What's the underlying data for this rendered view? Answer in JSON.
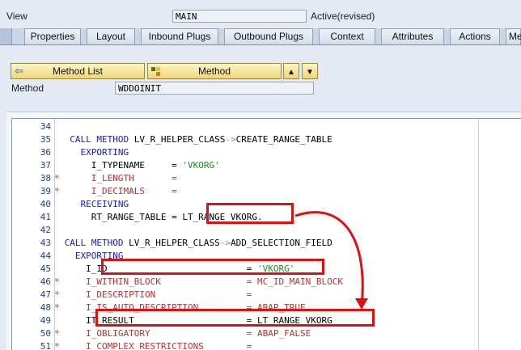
{
  "header": {
    "view_label": "View",
    "view_value": "MAIN",
    "status": "Active(revised)"
  },
  "tabs": [
    "Properties",
    "Layout",
    "Inbound Plugs",
    "Outbound Plugs",
    "Context",
    "Attributes",
    "Actions",
    "Me"
  ],
  "toolbar": {
    "method_list_label": "Method List",
    "method_label": "Method",
    "up_icon": "triangle-up-icon",
    "down_icon": "triangle-down-icon"
  },
  "method_field": {
    "label": "Method",
    "value": "WDDOINIT"
  },
  "code": {
    "lines": [
      {
        "num": "34",
        "marker": "",
        "text": ""
      },
      {
        "num": "35",
        "marker": "",
        "text": "  CALL METHOD LV_R_HELPER_CLASS->CREATE_RANGE_TABLE"
      },
      {
        "num": "36",
        "marker": "",
        "text": "    EXPORTING"
      },
      {
        "num": "37",
        "marker": "",
        "text": "      I_TYPENAME     = 'VKORG'"
      },
      {
        "num": "38",
        "marker": "*",
        "text": "      I_LENGTH       ="
      },
      {
        "num": "39",
        "marker": "*",
        "text": "      I_DECIMALS     ="
      },
      {
        "num": "40",
        "marker": "",
        "text": "    RECEIVING"
      },
      {
        "num": "41",
        "marker": "",
        "text": "      RT_RANGE_TABLE = LT_RANGE_VKORG."
      },
      {
        "num": "42",
        "marker": "",
        "text": ""
      },
      {
        "num": "43",
        "marker": "",
        "text": " CALL METHOD LV_R_HELPER_CLASS->ADD_SELECTION_FIELD"
      },
      {
        "num": "44",
        "marker": "",
        "text": "   EXPORTING"
      },
      {
        "num": "45",
        "marker": "",
        "text": "     I_ID                          = 'VKORG'"
      },
      {
        "num": "46",
        "marker": "*",
        "text": "     I_WITHIN_BLOCK                = MC_ID_MAIN_BLOCK"
      },
      {
        "num": "47",
        "marker": "*",
        "text": "     I_DESCRIPTION                 ="
      },
      {
        "num": "48",
        "marker": "*",
        "text": "     I_IS_AUTO_DESCRIPTION         = ABAP_TRUE"
      },
      {
        "num": "49",
        "marker": "",
        "text": "     IT_RESULT                     = LT_RANGE_VKORG"
      },
      {
        "num": "50",
        "marker": "*",
        "text": "     I_OBLIGATORY                  = ABAP_FALSE"
      },
      {
        "num": "51",
        "marker": "*",
        "text": "     I_COMPLEX_RESTRICTIONS        ="
      }
    ]
  },
  "colors": {
    "keyword": "#1818d8",
    "comment": "#c03030",
    "string": "#2a8a2a",
    "highlight": "#e01010"
  }
}
